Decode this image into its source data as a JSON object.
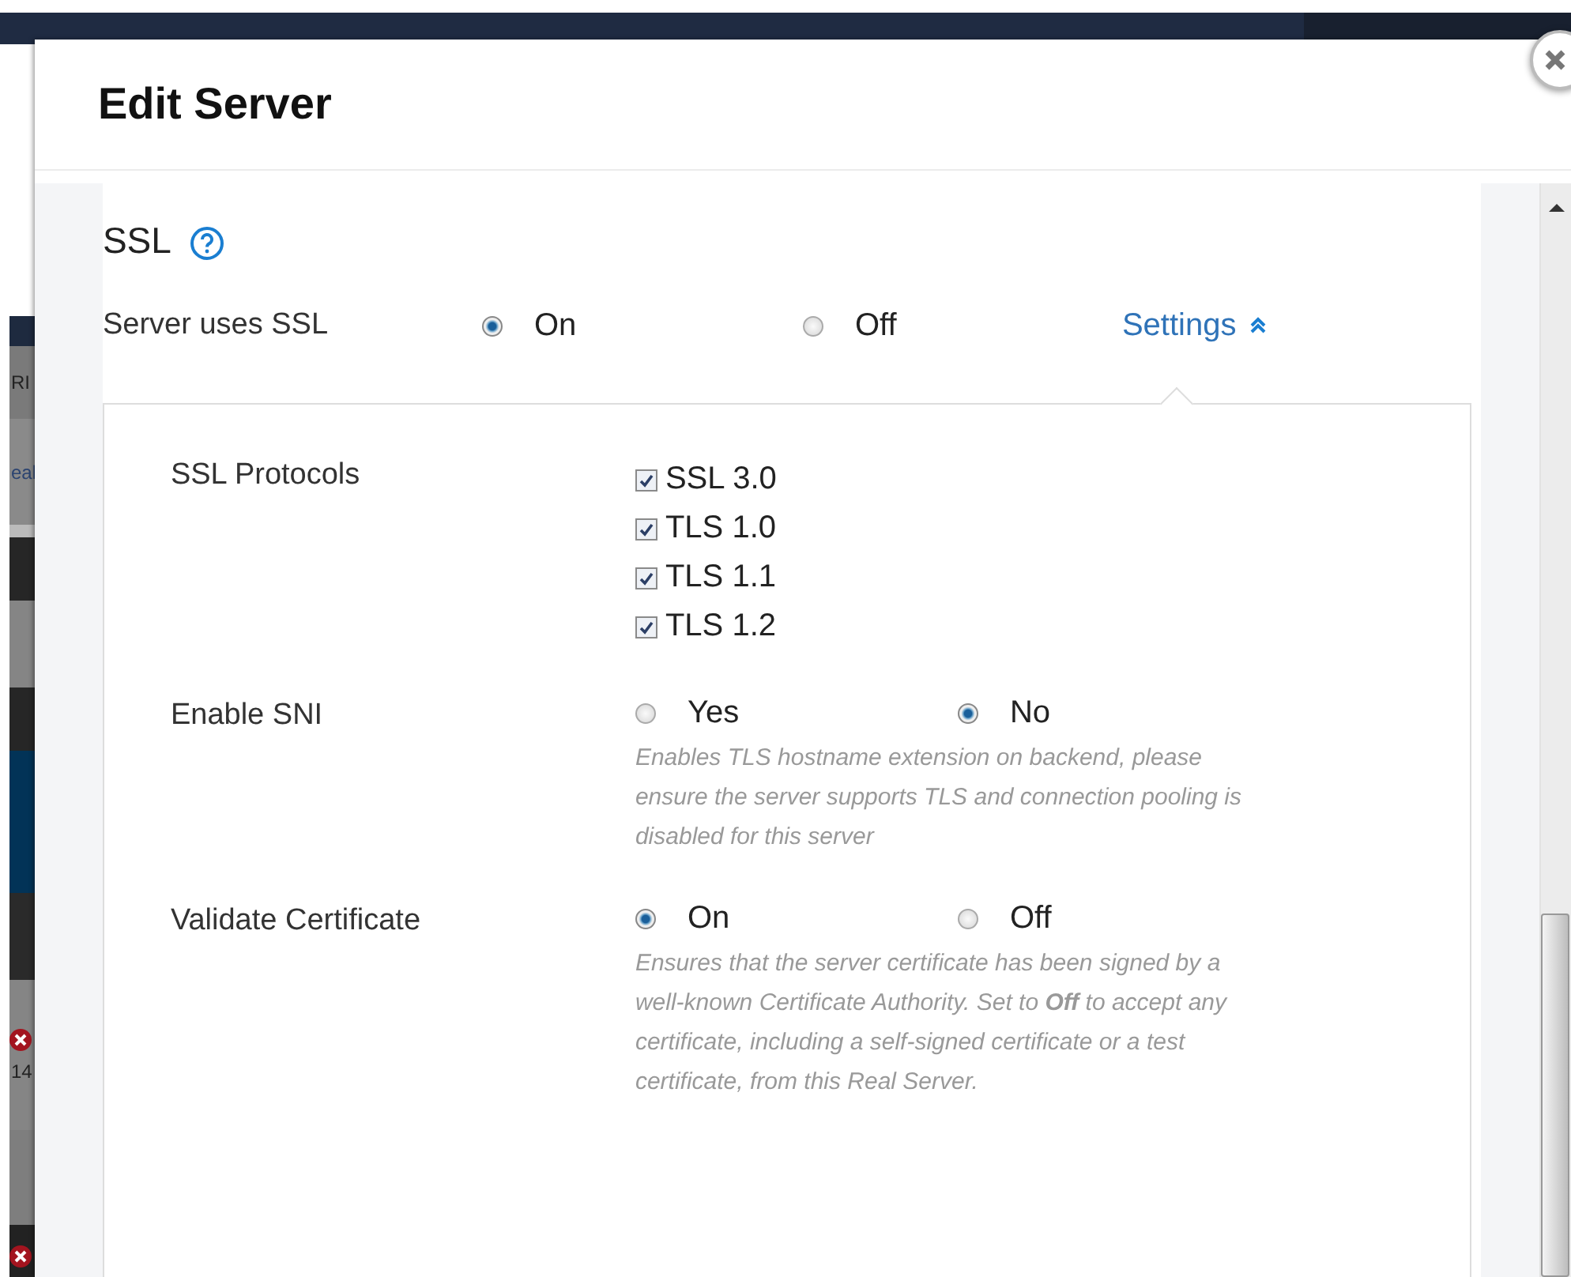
{
  "background": {
    "fragments": [
      "RI",
      "eal",
      "14"
    ]
  },
  "dialog": {
    "title": "Edit Server"
  },
  "section": {
    "title": "SSL"
  },
  "server_ssl": {
    "label": "Server uses SSL",
    "options": [
      {
        "label": "On",
        "selected": true
      },
      {
        "label": "Off",
        "selected": false
      }
    ],
    "settings_link": {
      "label": "Settings",
      "expanded": true
    }
  },
  "settings": {
    "rows": [
      {
        "kind": "checkboxes",
        "label": "SSL Protocols",
        "items": [
          {
            "label": "SSL 3.0",
            "checked": true
          },
          {
            "label": "TLS 1.0",
            "checked": true
          },
          {
            "label": "TLS 1.1",
            "checked": true
          },
          {
            "label": "TLS 1.2",
            "checked": true
          }
        ]
      },
      {
        "kind": "radios",
        "label": "Enable SNI",
        "options": [
          {
            "label": "Yes",
            "selected": false
          },
          {
            "label": "No",
            "selected": true
          }
        ],
        "help": "Enables TLS hostname extension on backend, please ensure the server supports TLS and connection pooling is disabled for this server"
      },
      {
        "kind": "radios",
        "label": "Validate Certificate",
        "options": [
          {
            "label": "On",
            "selected": true
          },
          {
            "label": "Off",
            "selected": false
          }
        ],
        "help": "Ensures that the server certificate has been signed by a well-known Certificate Authority. Set to **Off** to accept any certificate, including a self-signed certificate or a test certificate, from this Real Server."
      }
    ]
  }
}
